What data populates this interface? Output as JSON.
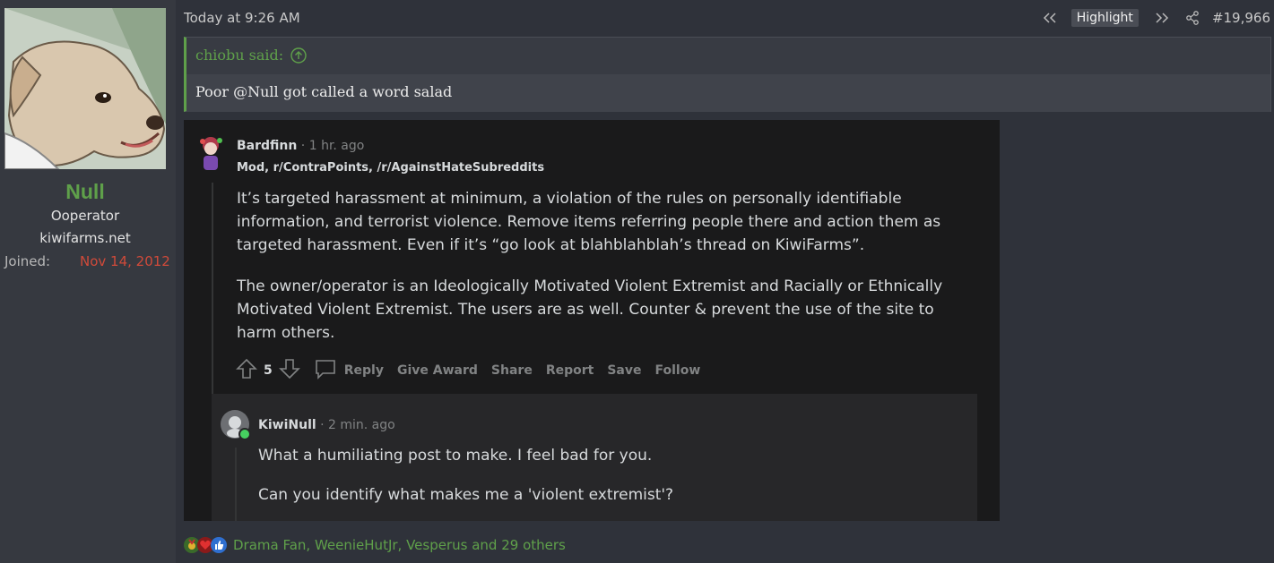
{
  "user": {
    "name": "Null",
    "title": "Ooperator",
    "site": "kiwifarms.net",
    "joined_label": "Joined:",
    "joined_value": "Nov 14, 2012"
  },
  "post": {
    "time": "Today at 9:26 AM",
    "highlight_label": "Highlight",
    "number": "#19,966"
  },
  "quote": {
    "author_line": "chiobu said:",
    "text": "Poor @Null got called a word salad"
  },
  "embed": {
    "comment1": {
      "user": "Bardfinn",
      "meta": " · 1 hr. ago",
      "flair": "Mod, r/ContraPoints, /r/AgainstHateSubreddits",
      "para1": "It’s targeted harassment at minimum, a violation of the rules on personally identifiable information, and terrorist violence. Remove items referring people there and action them as targeted harassment. Even if it’s “go look at blahblahblah’s thread on KiwiFarms”.",
      "para2": "The owner/operator is an Ideologically Motivated Violent Extremist and Racially or Ethnically Motivated Violent Extremist. The users are as well. Counter & prevent the use of the site to harm others.",
      "votes": "5",
      "actions": [
        "Reply",
        "Give Award",
        "Share",
        "Report",
        "Save",
        "Follow"
      ]
    },
    "comment2": {
      "user": "KiwiNull",
      "meta": " · 2 min. ago",
      "para1": "What a humiliating post to make. I feel bad for you.",
      "para2": "Can you identify what makes me a 'violent extremist'?"
    }
  },
  "reactions": {
    "text": "Drama Fan, WeenieHutJr, Vesperus and 29 others",
    "icons": [
      "medal-icon",
      "heart-icon",
      "like-icon"
    ]
  },
  "colors": {
    "accent_green": "#5fa04a",
    "joined_red": "#d04a3a",
    "background": "#2f323a"
  }
}
